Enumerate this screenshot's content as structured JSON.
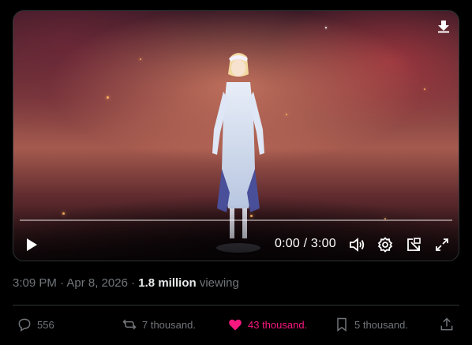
{
  "video": {
    "time_display": "0:00 / 3:00",
    "progress_fraction": 0.0
  },
  "meta": {
    "time": "3:09 PM",
    "separator1": " · ",
    "date": "Apr 8, 2026",
    "separator2": " · ",
    "views_count": "1.8 million",
    "views_label": " viewing"
  },
  "actions": {
    "replies": "556",
    "reposts": "7 thousand.",
    "likes": "43 thousand.",
    "bookmarks": "5 thousand."
  },
  "colors": {
    "like_accent": "#f91880",
    "muted_text": "#71767b",
    "divider": "#2f3336"
  },
  "icons": [
    "download-icon",
    "play-icon",
    "volume-icon",
    "settings-icon",
    "pop-out-icon",
    "fullscreen-icon",
    "reply-icon",
    "repost-icon",
    "like-icon",
    "bookmark-icon",
    "share-icon"
  ]
}
